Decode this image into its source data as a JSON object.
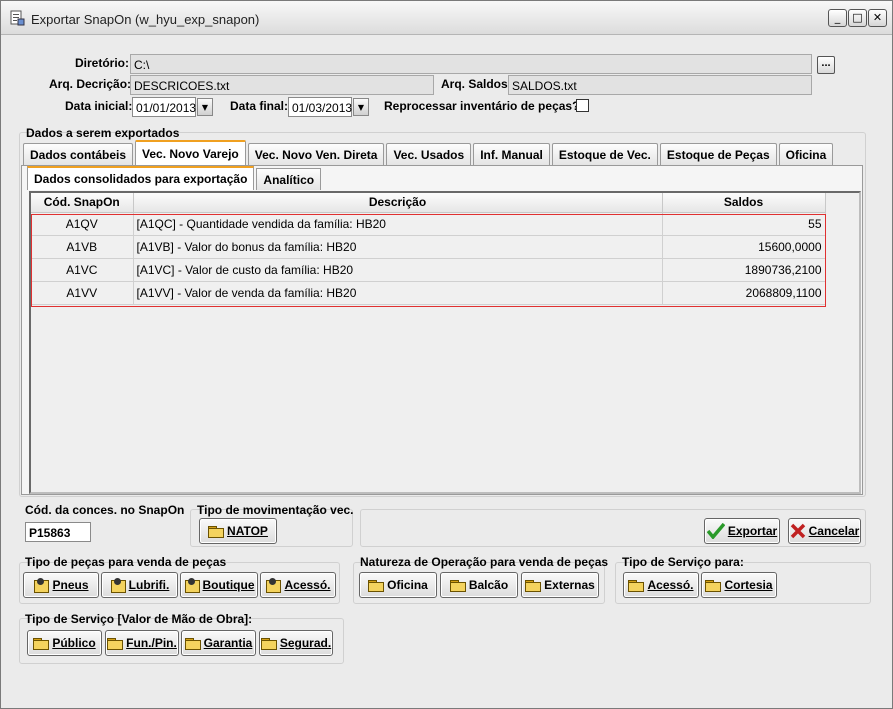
{
  "window": {
    "title": "Exportar SnapOn (w_hyu_exp_snapon)",
    "controls": [
      "_",
      "□",
      "✕"
    ]
  },
  "form": {
    "diretorio_label": "Diretório:",
    "diretorio_value": "C:\\",
    "browse_label": "...",
    "arq_decricao_label": "Arq. Decrição:",
    "arq_decricao_value": "DESCRICOES.txt",
    "arq_saldos_label": "Arq. Saldos:",
    "arq_saldos_value": "SALDOS.txt",
    "data_inicial_label": "Data inicial:",
    "data_inicial_value": "01/01/2013",
    "data_final_label": "Data final:",
    "data_final_value": "01/03/2013",
    "reprocessar_label": "Reprocessar inventário de peças?",
    "reprocessar_checked": false
  },
  "export_section": {
    "title": "Dados a serem exportados",
    "tabs": [
      {
        "label": "Dados contábeis",
        "active": false
      },
      {
        "label": "Vec. Novo Varejo",
        "active": true
      },
      {
        "label": "Vec. Novo Ven. Direta",
        "active": false
      },
      {
        "label": "Vec. Usados",
        "active": false
      },
      {
        "label": "Inf. Manual",
        "active": false
      },
      {
        "label": "Estoque de Vec.",
        "active": false
      },
      {
        "label": "Estoque de Peças",
        "active": false
      },
      {
        "label": "Oficina",
        "active": false
      }
    ],
    "subtabs": [
      {
        "label": "Dados consolidados para exportação",
        "active": true
      },
      {
        "label": "Analítico",
        "active": false
      }
    ],
    "table": {
      "headers": [
        "Cód. SnapOn",
        "Descrição",
        "Saldos"
      ],
      "rows": [
        {
          "cod": "A1QV",
          "desc": "[A1QC] - Quantidade vendida da família: HB20",
          "saldo": "55"
        },
        {
          "cod": "A1VB",
          "desc": "[A1VB] - Valor do bonus da família: HB20",
          "saldo": "15600,0000"
        },
        {
          "cod": "A1VC",
          "desc": "[A1VC] - Valor de custo da família: HB20",
          "saldo": "1890736,2100"
        },
        {
          "cod": "A1VV",
          "desc": "[A1VV] - Valor de venda da família: HB20",
          "saldo": "2068809,1100"
        }
      ]
    }
  },
  "bottom": {
    "cod_conces_label": "Cód. da conces. no SnapOn",
    "cod_conces_value": "P15863",
    "tipo_mov_label": "Tipo de movimentação vec.",
    "natop_label": "NATOP",
    "exportar_label": "Exportar",
    "cancelar_label": "Cancelar",
    "pecas_label": "Tipo de peças para venda de peças",
    "pecas_buttons": [
      "Pneus",
      "Lubrifi.",
      "Boutique",
      "Acessó."
    ],
    "natureza_label": "Natureza de Operação para venda de peças",
    "natureza_buttons": [
      "Oficina",
      "Balcão",
      "Externas"
    ],
    "servico_para_label": "Tipo de Serviço para:",
    "servico_para_buttons": [
      "Acessó.",
      "Cortesia"
    ],
    "servico_mao_label": "Tipo de Serviço [Valor de Mão de Obra]:",
    "servico_mao_buttons": [
      "Público",
      "Fun./Pin.",
      "Garantia",
      "Segurad."
    ]
  },
  "colors": {
    "selection_outline": "#e03030",
    "active_tab_accent": "#f0a020",
    "export_check": "#2a9a2a",
    "cancel_x": "#c02020"
  }
}
